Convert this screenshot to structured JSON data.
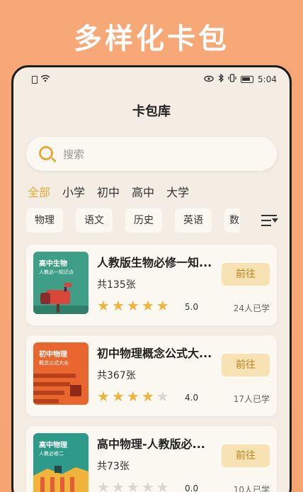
{
  "promo": {
    "title": "多样化卡包"
  },
  "status_bar": {
    "time": "5:04"
  },
  "page": {
    "title": "卡包库"
  },
  "search": {
    "placeholder": "搜索"
  },
  "level_tabs": [
    "全部",
    "小学",
    "初中",
    "高中",
    "大学"
  ],
  "subjects": [
    "物理",
    "语文",
    "历史",
    "英语",
    "数"
  ],
  "colors": {
    "accent": "#e8a83a",
    "star_on": "#f0b43a",
    "star_off": "#d9d6d0",
    "button_bg": "#f7e2b4"
  },
  "cards": [
    {
      "thumb_title": "高中生物",
      "thumb_sub": "人教必一知识点",
      "title": "人教版生物必修一知...",
      "count": "共135张",
      "stars": 5,
      "rating": "5.0",
      "button": "前往",
      "learners": "24人已学"
    },
    {
      "thumb_title": "初中物理",
      "thumb_sub": "概念公式大全",
      "title": "初中物理概念公式大...",
      "count": "共367张",
      "stars": 4,
      "rating": "4.0",
      "button": "前往",
      "learners": "17人已学"
    },
    {
      "thumb_title": "高中物理",
      "thumb_sub": "人教必修二",
      "title": "高中物理-人教版必...",
      "count": "共73张",
      "stars": 0,
      "rating": "0.0",
      "button": "前往",
      "learners": "10人已学"
    }
  ]
}
